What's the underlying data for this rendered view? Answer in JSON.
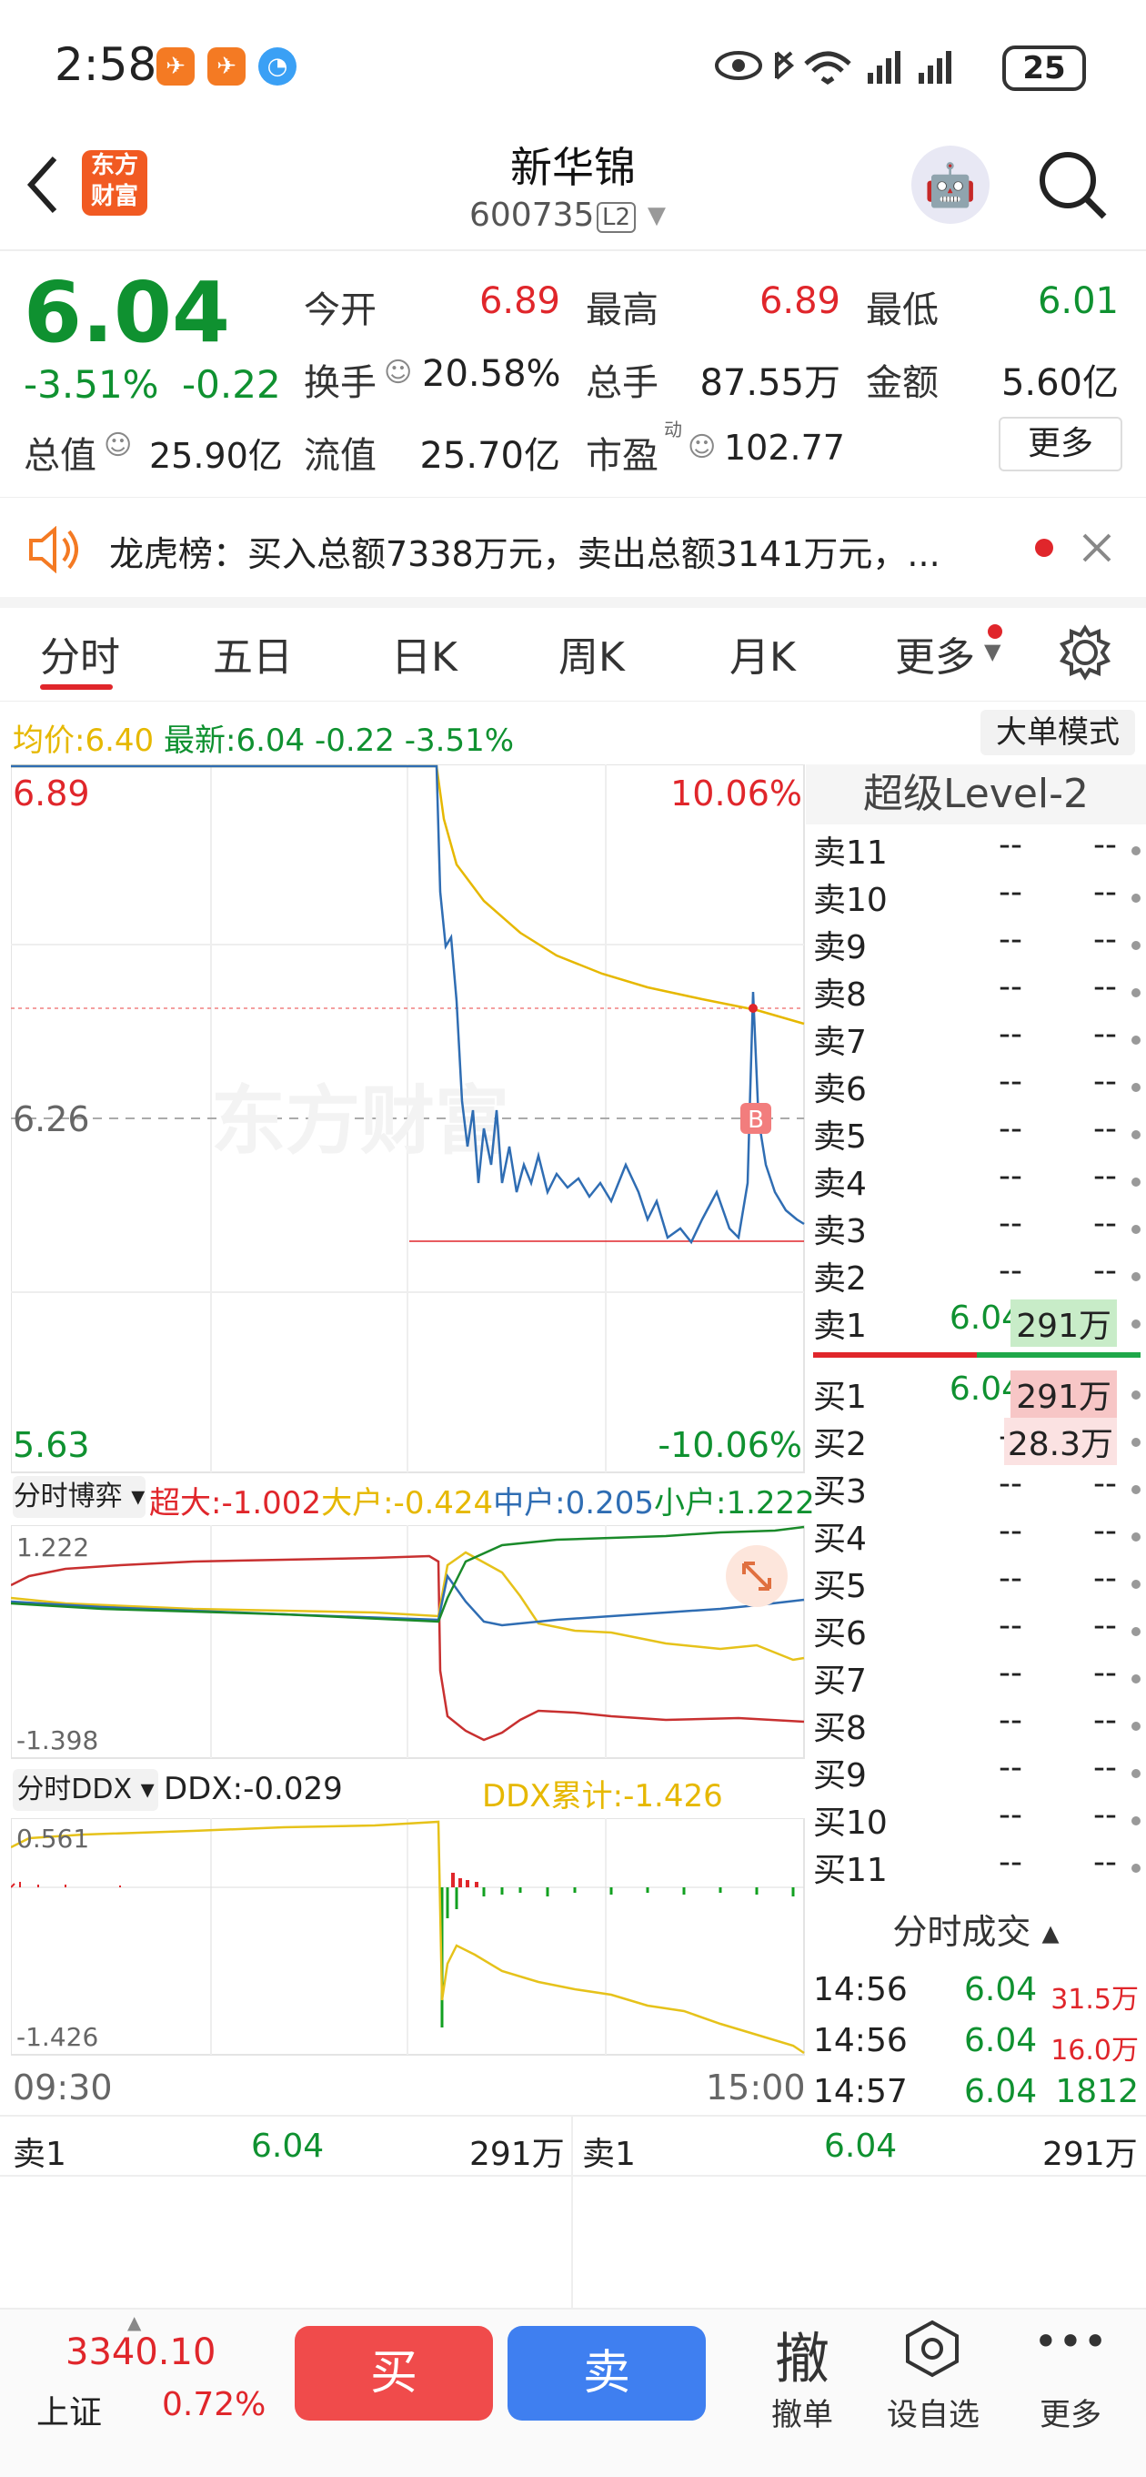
{
  "status": {
    "time": "2:58",
    "battery": "25"
  },
  "header": {
    "title": "新华锦",
    "code": "600735",
    "level_badge": "L2",
    "logo_text": "东方财富"
  },
  "quote": {
    "price": "6.04",
    "change_pct": "-3.51%",
    "change": "-0.22",
    "open_label": "今开",
    "open": "6.89",
    "high_label": "最高",
    "high": "6.89",
    "low_label": "最低",
    "low": "6.01",
    "turnover_label": "换手",
    "turnover": "20.58%",
    "volume_label": "总手",
    "volume": "87.55万",
    "amount_label": "金额",
    "amount": "5.60亿",
    "mktcap_label": "总值",
    "mktcap": "25.90亿",
    "float_label": "流值",
    "float_cap": "25.70亿",
    "pe_label": "市盈",
    "pe_sup": "动",
    "pe": "102.77",
    "more": "更多"
  },
  "notice": {
    "text": "龙虎榜：买入总额7338万元，卖出总额3141万元，..."
  },
  "tabs": [
    "分时",
    "五日",
    "日K",
    "周K",
    "月K",
    "更多"
  ],
  "info": {
    "avg_label": "均价:",
    "avg": "6.40",
    "latest_label": "最新:",
    "latest": "6.04",
    "chg": "-0.22",
    "pct": "-3.51%",
    "big_mode": "大单模式"
  },
  "chart": {
    "y_max": "6.89",
    "y_mid": "6.26",
    "y_min": "5.63",
    "pct_max": "10.06%",
    "pct_min": "-10.06%",
    "watermark": "东方财富",
    "marker": "B",
    "time_start": "09:30",
    "time_end": "15:00"
  },
  "panel1": {
    "selector": "分时博弈",
    "super_label": "超大:",
    "super": "-1.002",
    "big_label": "大户:",
    "big": "-0.424",
    "mid_label": "中户:",
    "mid": "0.205",
    "small_label": "小户:",
    "small": "1.222",
    "top": "1.222",
    "bottom": "-1.398"
  },
  "panel2": {
    "selector": "分时DDX",
    "ddx_label": "DDX:",
    "ddx": "-0.029",
    "cum_label": "DDX累计:",
    "cum": "-1.426",
    "top": "0.561",
    "bottom": "-1.426"
  },
  "orderbook": {
    "title": "超级Level-2",
    "asks": [
      {
        "name": "卖11",
        "price": "--",
        "vol": "--"
      },
      {
        "name": "卖10",
        "price": "--",
        "vol": "--"
      },
      {
        "name": "卖9",
        "price": "--",
        "vol": "--"
      },
      {
        "name": "卖8",
        "price": "--",
        "vol": "--"
      },
      {
        "name": "卖7",
        "price": "--",
        "vol": "--"
      },
      {
        "name": "卖6",
        "price": "--",
        "vol": "--"
      },
      {
        "name": "卖5",
        "price": "--",
        "vol": "--"
      },
      {
        "name": "卖4",
        "price": "--",
        "vol": "--"
      },
      {
        "name": "卖3",
        "price": "--",
        "vol": "--"
      },
      {
        "name": "卖2",
        "price": "--",
        "vol": "--"
      },
      {
        "name": "卖1",
        "price": "6.04",
        "vol": "291万"
      }
    ],
    "bids": [
      {
        "name": "买1",
        "price": "6.04",
        "vol": "291万"
      },
      {
        "name": "买2",
        "price": "--",
        "vol": "28.3万"
      },
      {
        "name": "买3",
        "price": "--",
        "vol": "--"
      },
      {
        "name": "买4",
        "price": "--",
        "vol": "--"
      },
      {
        "name": "买5",
        "price": "--",
        "vol": "--"
      },
      {
        "name": "买6",
        "price": "--",
        "vol": "--"
      },
      {
        "name": "买7",
        "price": "--",
        "vol": "--"
      },
      {
        "name": "买8",
        "price": "--",
        "vol": "--"
      },
      {
        "name": "买9",
        "price": "--",
        "vol": "--"
      },
      {
        "name": "买10",
        "price": "--",
        "vol": "--"
      },
      {
        "name": "买11",
        "price": "--",
        "vol": "--"
      }
    ]
  },
  "trades": {
    "title": "分时成交",
    "rows": [
      {
        "time": "14:56",
        "price": "6.04",
        "vol": "31.5万"
      },
      {
        "time": "14:56",
        "price": "6.04",
        "vol": "16.0万"
      },
      {
        "time": "14:57",
        "price": "6.04",
        "vol": "1812"
      }
    ]
  },
  "summary": {
    "left": {
      "name": "卖1",
      "price": "6.04",
      "vol": "291万"
    },
    "right": {
      "name": "卖1",
      "price": "6.04",
      "vol": "291万"
    }
  },
  "bottom": {
    "index_value": "3340.10",
    "index_name": "上证",
    "index_pct": "0.72%",
    "buy": "买",
    "sell": "卖",
    "cancel_glyph": "撤",
    "cancel": "撤单",
    "watch": "设自选",
    "more": "更多"
  }
}
